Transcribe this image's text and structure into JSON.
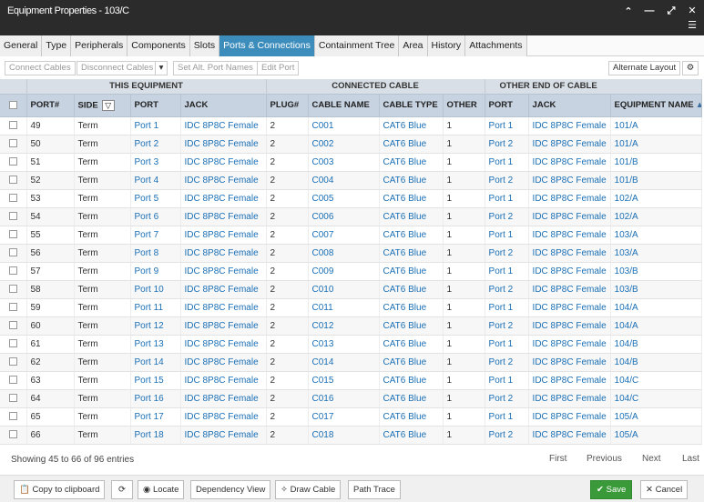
{
  "window": {
    "title": "Equipment Properties - 103/C"
  },
  "tabs": [
    "General",
    "Type",
    "Peripherals",
    "Components",
    "Slots",
    "Ports & Connections",
    "Containment Tree",
    "Area",
    "History",
    "Attachments"
  ],
  "active_tab": "Ports & Connections",
  "toolbar": {
    "connect_cables": "Connect Cables",
    "disconnect_cables": "Disconnect Cables",
    "set_alt_port_names": "Set Alt. Port Names",
    "edit_port": "Edit Port",
    "alternate_layout": "Alternate Layout"
  },
  "grid": {
    "groups": {
      "this_equipment": "THIS EQUIPMENT",
      "connected_cable": "CONNECTED CABLE",
      "other_end": "OTHER END OF CABLE"
    },
    "columns": [
      "PORT#",
      "SIDE",
      "PORT",
      "JACK",
      "PLUG#",
      "CABLE NAME",
      "CABLE TYPE",
      "OTHER",
      "PORT",
      "JACK",
      "EQUIPMENT NAME"
    ],
    "rows": [
      [
        "49",
        "Term",
        "Port 1",
        "IDC 8P8C Female",
        "2",
        "C001",
        "CAT6 Blue",
        "1",
        "Port 1",
        "IDC 8P8C Female",
        "101/A"
      ],
      [
        "50",
        "Term",
        "Port 2",
        "IDC 8P8C Female",
        "2",
        "C002",
        "CAT6 Blue",
        "1",
        "Port 2",
        "IDC 8P8C Female",
        "101/A"
      ],
      [
        "51",
        "Term",
        "Port 3",
        "IDC 8P8C Female",
        "2",
        "C003",
        "CAT6 Blue",
        "1",
        "Port 1",
        "IDC 8P8C Female",
        "101/B"
      ],
      [
        "52",
        "Term",
        "Port 4",
        "IDC 8P8C Female",
        "2",
        "C004",
        "CAT6 Blue",
        "1",
        "Port 2",
        "IDC 8P8C Female",
        "101/B"
      ],
      [
        "53",
        "Term",
        "Port 5",
        "IDC 8P8C Female",
        "2",
        "C005",
        "CAT6 Blue",
        "1",
        "Port 1",
        "IDC 8P8C Female",
        "102/A"
      ],
      [
        "54",
        "Term",
        "Port 6",
        "IDC 8P8C Female",
        "2",
        "C006",
        "CAT6 Blue",
        "1",
        "Port 2",
        "IDC 8P8C Female",
        "102/A"
      ],
      [
        "55",
        "Term",
        "Port 7",
        "IDC 8P8C Female",
        "2",
        "C007",
        "CAT6 Blue",
        "1",
        "Port 1",
        "IDC 8P8C Female",
        "103/A"
      ],
      [
        "56",
        "Term",
        "Port 8",
        "IDC 8P8C Female",
        "2",
        "C008",
        "CAT6 Blue",
        "1",
        "Port 2",
        "IDC 8P8C Female",
        "103/A"
      ],
      [
        "57",
        "Term",
        "Port 9",
        "IDC 8P8C Female",
        "2",
        "C009",
        "CAT6 Blue",
        "1",
        "Port 1",
        "IDC 8P8C Female",
        "103/B"
      ],
      [
        "58",
        "Term",
        "Port 10",
        "IDC 8P8C Female",
        "2",
        "C010",
        "CAT6 Blue",
        "1",
        "Port 2",
        "IDC 8P8C Female",
        "103/B"
      ],
      [
        "59",
        "Term",
        "Port 11",
        "IDC 8P8C Female",
        "2",
        "C011",
        "CAT6 Blue",
        "1",
        "Port 1",
        "IDC 8P8C Female",
        "104/A"
      ],
      [
        "60",
        "Term",
        "Port 12",
        "IDC 8P8C Female",
        "2",
        "C012",
        "CAT6 Blue",
        "1",
        "Port 2",
        "IDC 8P8C Female",
        "104/A"
      ],
      [
        "61",
        "Term",
        "Port 13",
        "IDC 8P8C Female",
        "2",
        "C013",
        "CAT6 Blue",
        "1",
        "Port 1",
        "IDC 8P8C Female",
        "104/B"
      ],
      [
        "62",
        "Term",
        "Port 14",
        "IDC 8P8C Female",
        "2",
        "C014",
        "CAT6 Blue",
        "1",
        "Port 2",
        "IDC 8P8C Female",
        "104/B"
      ],
      [
        "63",
        "Term",
        "Port 15",
        "IDC 8P8C Female",
        "2",
        "C015",
        "CAT6 Blue",
        "1",
        "Port 1",
        "IDC 8P8C Female",
        "104/C"
      ],
      [
        "64",
        "Term",
        "Port 16",
        "IDC 8P8C Female",
        "2",
        "C016",
        "CAT6 Blue",
        "1",
        "Port 2",
        "IDC 8P8C Female",
        "104/C"
      ],
      [
        "65",
        "Term",
        "Port 17",
        "IDC 8P8C Female",
        "2",
        "C017",
        "CAT6 Blue",
        "1",
        "Port 1",
        "IDC 8P8C Female",
        "105/A"
      ],
      [
        "66",
        "Term",
        "Port 18",
        "IDC 8P8C Female",
        "2",
        "C018",
        "CAT6 Blue",
        "1",
        "Port 2",
        "IDC 8P8C Female",
        "105/A"
      ]
    ]
  },
  "footer": {
    "info": "Showing 45 to 66 of 96 entries",
    "first": "First",
    "previous": "Previous",
    "next": "Next",
    "last": "Last"
  },
  "bottom": {
    "copy": "Copy to clipboard",
    "locate": "Locate",
    "dependency": "Dependency View",
    "draw_cable": "Draw Cable",
    "path_trace": "Path Trace",
    "save": "Save",
    "cancel": "Cancel"
  },
  "icons": {
    "collapse": "chevron-up-icon",
    "minimize": "minimize-icon",
    "maximize": "expand-icon",
    "close": "close-icon",
    "menu": "hamburger-menu-icon",
    "settings": "gear-icon",
    "refresh": "refresh-icon",
    "sort": "sort-ascending-icon",
    "filter": "filter-icon"
  },
  "colors": {
    "titlebar": "#2b2b2b",
    "active_tab": "#3c8dbc",
    "link": "#1a6fb5",
    "save": "#3a9a3a"
  }
}
